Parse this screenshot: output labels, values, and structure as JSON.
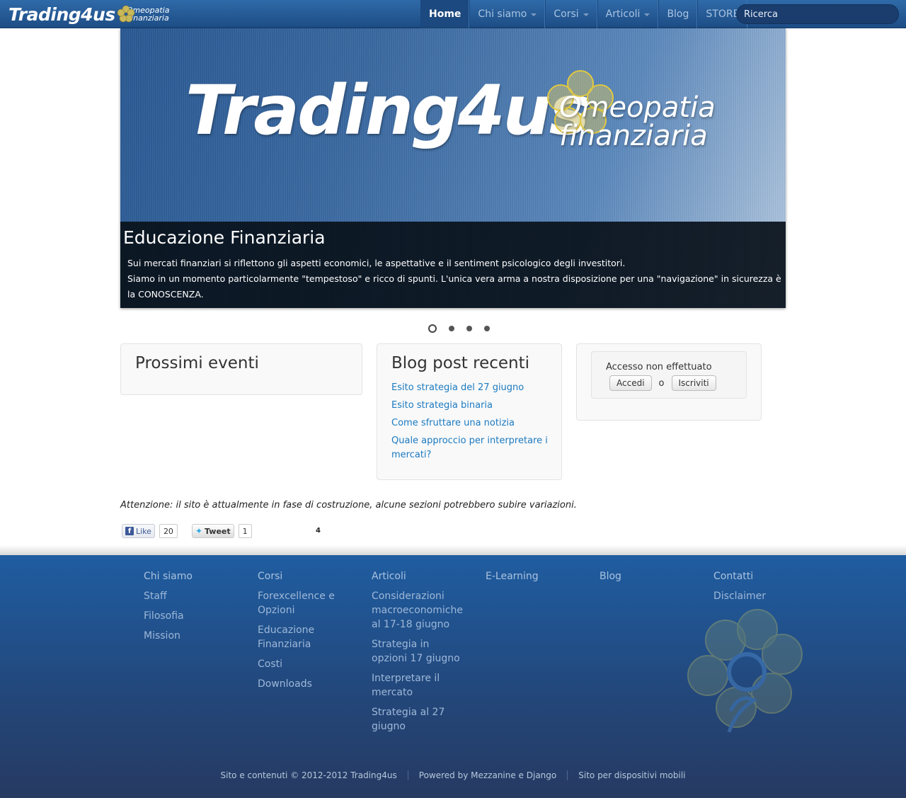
{
  "navbar": {
    "brand_main": "Trading4us",
    "brand_sub_1": "Omeopatia",
    "brand_sub_2": "Finanziaria",
    "items": [
      {
        "label": "Home",
        "active": true
      },
      {
        "label": "Chi siamo",
        "dropdown": true
      },
      {
        "label": "Corsi",
        "dropdown": true
      },
      {
        "label": "Articoli",
        "dropdown": true
      },
      {
        "label": "Blog"
      },
      {
        "label": "STORE"
      }
    ],
    "search_placeholder": "Ricerca"
  },
  "hero": {
    "logo_main": "Trading4us",
    "logo_sub_1": "Omeopatia",
    "logo_sub_2": "finanziaria",
    "caption_title": "Educazione Finanziaria",
    "caption_line1": "Sui mercati finanziari si riflettono gli aspetti economici, le aspettative e il sentiment psicologico degli investitori.",
    "caption_line2": "Siamo in un momento particolarmente \"tempestoso\" e ricco di spunti. L'unica vera arma a nostra disposizione per una \"navigazione\" in sicurezza è la CONOSCENZA.",
    "slide_count": 4,
    "active_slide": 1
  },
  "events": {
    "title": "Prossimi eventi"
  },
  "blog": {
    "title": "Blog post recenti",
    "posts": [
      "Esito strategia del 27 giugno",
      "Esito strategia binaria",
      "Come sfruttare una notizia",
      "Quale approccio per interpretare i mercati?"
    ]
  },
  "login": {
    "status": "Accesso non effettuato",
    "login_label": "Accedi",
    "or_label": "o",
    "signup_label": "Iscriviti"
  },
  "notice": "Attenzione: il sito è attualmente in fase di costruzione, alcune sezioni potrebbero subire variazioni.",
  "social": {
    "like_label": "Like",
    "like_count": "20",
    "tweet_label": "Tweet",
    "tweet_count": "1",
    "plus_count": "4"
  },
  "footer": {
    "columns": [
      [
        "Chi siamo",
        "Staff",
        "Filosofia",
        "Mission"
      ],
      [
        "Corsi",
        "Forexcellence e Opzioni",
        "Educazione Finanziaria",
        "Costi",
        "Downloads"
      ],
      [
        "Articoli",
        "Considerazioni macroeconomiche al 17-18 giugno",
        "Strategia in opzioni 17 giugno",
        "Interpretare il mercato",
        "Strategia al 27 giugno"
      ],
      [
        "E-Learning"
      ],
      [
        "Blog"
      ],
      [
        "Contatti",
        "Disclaimer"
      ]
    ],
    "copyright": "Sito e contenuti © 2012-2012 Trading4us",
    "powered": "Powered by Mezzanine e Django",
    "mobile": "Sito per dispositivi mobili"
  },
  "colors": {
    "nav": "#2f6aa8",
    "link": "#1b7ac1",
    "footer": "#234679"
  }
}
